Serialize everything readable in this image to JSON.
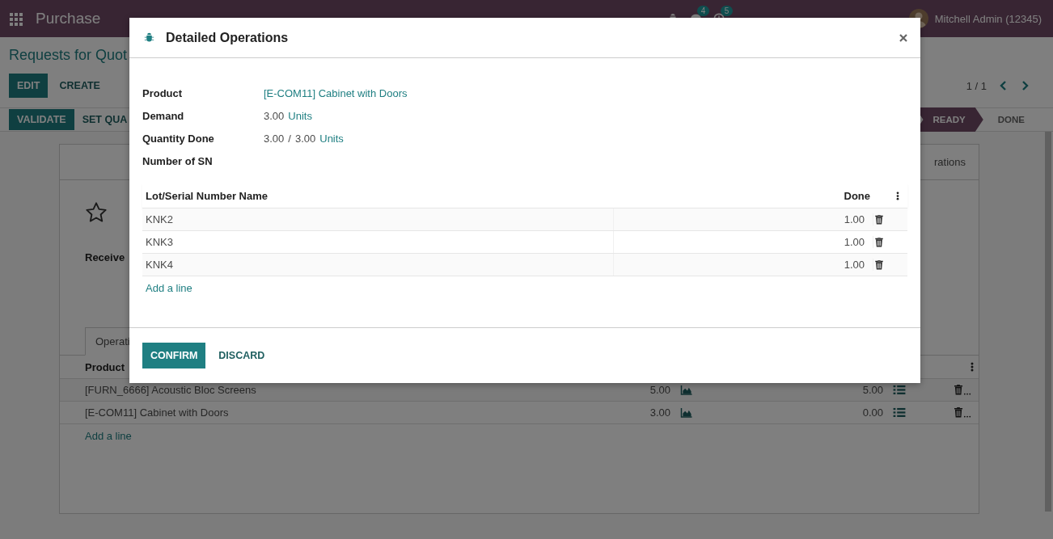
{
  "navbar": {
    "app_name": "Purchase",
    "messages_count": "4",
    "activities_count": "5",
    "user": "Mitchell Admin (12345)"
  },
  "control_panel": {
    "breadcrumb": "Requests for Quot",
    "buttons": [
      {
        "label": "EDIT",
        "primary": true
      },
      {
        "label": "CREATE",
        "primary": false
      }
    ],
    "pager": "1 / 1"
  },
  "status_bar": {
    "buttons": [
      {
        "label": "VALIDATE",
        "primary": true
      },
      {
        "label": "SET QUA",
        "primary": false
      }
    ],
    "stages": [
      {
        "label": "READY",
        "selected": true
      },
      {
        "label": "DONE",
        "selected": false
      }
    ]
  },
  "form": {
    "button_box_label": "rations",
    "starred": false,
    "field_label": "Receive",
    "notebook_tab": "Operati",
    "table": {
      "columns": [
        "Product"
      ],
      "rows": [
        {
          "product": "[FURN_6666] Acoustic Bloc Screens",
          "demand": "5.00",
          "done": "5.00"
        },
        {
          "product": "[E-COM11] Cabinet with Doors",
          "demand": "3.00",
          "done": "0.00"
        }
      ],
      "add_line": "Add a line"
    }
  },
  "dialog": {
    "title": "Detailed Operations",
    "fields": [
      {
        "label": "Product",
        "values": [
          {
            "text": "[E-COM11] Cabinet with Doors",
            "link": true
          }
        ]
      },
      {
        "label": "Demand",
        "values": [
          {
            "text": "3.00",
            "link": false
          },
          {
            "text": "Units",
            "link": true
          }
        ]
      },
      {
        "label": "Quantity Done",
        "values": [
          {
            "text": "3.00",
            "link": false
          },
          {
            "text": "/",
            "link": false
          },
          {
            "text": "3.00",
            "link": false
          },
          {
            "text": "Units",
            "link": true
          }
        ]
      },
      {
        "label": "Number of SN"
      }
    ],
    "table": {
      "columns": [
        "Lot/Serial Number Name",
        "Done"
      ],
      "rows": [
        {
          "name": "KNK2",
          "done": "1.00"
        },
        {
          "name": "KNK3",
          "done": "1.00"
        },
        {
          "name": "KNK4",
          "done": "1.00"
        }
      ],
      "add_line": "Add a line"
    },
    "buttons": [
      {
        "label": "CONFIRM",
        "primary": true
      },
      {
        "label": "DISCARD",
        "primary": false
      }
    ]
  }
}
